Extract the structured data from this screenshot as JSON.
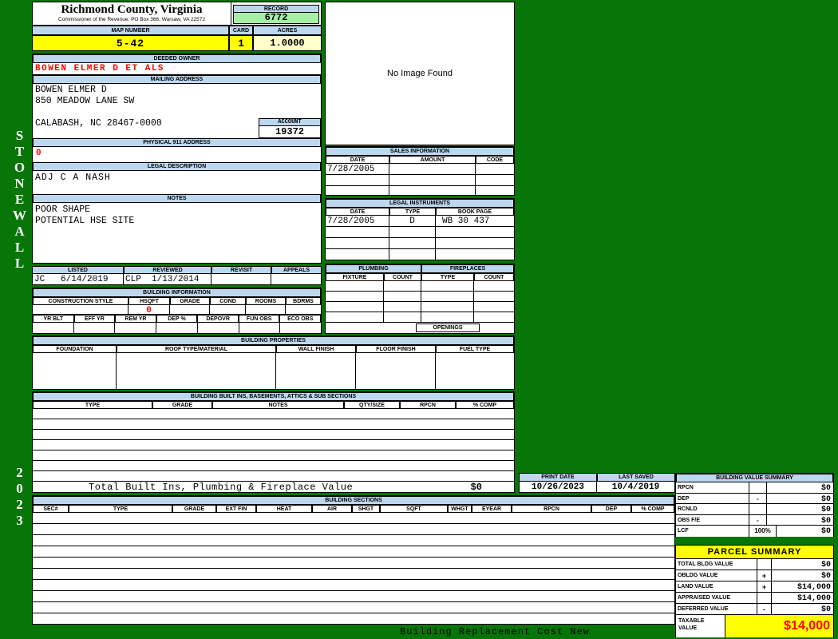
{
  "colors": {
    "page_background": "#077507",
    "section_header_blue": "#BDD7EE",
    "highlight_yellow": "#FFFF00",
    "acres_cream": "#FFFFCC",
    "record_green": "#A6F0A6",
    "alert_red": "#FF0000"
  },
  "sidebar": {
    "district": "STONEWALL",
    "year": "2023"
  },
  "header": {
    "county_title": "Richmond County, Virginia",
    "county_subtitle": "Commissioner of the Revenue, PO Box 366, Warsaw, VA 22572",
    "record_label": "RECORD",
    "record_value": "6772",
    "map_number_label": "MAP NUMBER",
    "map_number_value": "5-42",
    "card_label": "CARD",
    "card_value": "1",
    "acres_label": "ACRES",
    "acres_value": "1.0000"
  },
  "image_box": {
    "message": "No Image Found"
  },
  "owner": {
    "deeded_owner_label": "DEEDED OWNER",
    "deeded_owner": "BOWEN ELMER D ET ALS",
    "mailing_address_label": "MAILING ADDRESS",
    "mailing_line1": "BOWEN ELMER D",
    "mailing_line2": "850 MEADOW LANE SW",
    "mailing_line3": "CALABASH, NC 28467-0000",
    "account_label": "ACCOUNT",
    "account_value": "19372",
    "physical_address_label": "PHYSICAL 911 ADDRESS",
    "physical_address_value": "0",
    "legal_description_label": "LEGAL DESCRIPTION",
    "legal_description": "ADJ C A NASH",
    "notes_label": "NOTES",
    "notes_line1": "POOR SHAPE",
    "notes_line2": "POTENTIAL HSE SITE"
  },
  "sales": {
    "title": "SALES INFORMATION",
    "columns": [
      "DATE",
      "AMOUNT",
      "CODE"
    ],
    "row1": {
      "date": "7/28/2005"
    }
  },
  "legal_instruments": {
    "title": "LEGAL INSTRUMENTS",
    "columns": [
      "DATE",
      "TYPE",
      "BOOK PAGE"
    ],
    "row1": {
      "date": "7/28/2005",
      "type": "D",
      "book_page": "WB 30 437"
    }
  },
  "plumbing": {
    "title": "PLUMBING",
    "columns": [
      "FIXTURE",
      "COUNT"
    ],
    "fireplaces_title": "FIREPLACES",
    "fireplaces_columns": [
      "TYPE",
      "COUNT"
    ],
    "openings_label": "OPENINGS"
  },
  "review": {
    "columns": [
      "LISTED",
      "REVIEWED",
      "REVISIT",
      "APPEALS"
    ],
    "listed_value": "JC   6/14/2019",
    "reviewed_value": "CLP  1/13/2014"
  },
  "building_info": {
    "title": "BUILDING INFORMATION",
    "columns_top": [
      "CONSTRUCTION STYLE",
      "HSQFT",
      "GRADE",
      "COND",
      "ROOMS",
      "BDRMS"
    ],
    "hsqft_value": "0",
    "columns_bottom": [
      "YR BLT",
      "EFF YR",
      "REM YR",
      "DEP %",
      "DEPOVR",
      "FUN OBS",
      "ECO OBS"
    ]
  },
  "building_properties": {
    "title": "BUILDING PROPERTIES",
    "columns": [
      "FOUNDATION",
      "ROOF TYPE/MATERIAL",
      "WALL FINISH",
      "FLOOR FINISH",
      "FUEL TYPE"
    ]
  },
  "built_ins": {
    "title": "BUILDING BUILT INS, BASEMENTS, ATTICS & SUB SECTIONS",
    "columns": [
      "TYPE",
      "GRADE",
      "NOTES",
      "QTY/SIZE",
      "RPCN",
      "% COMP"
    ],
    "total_label": "Total Built Ins, Plumbing & Fireplace Value",
    "total_value": "$0"
  },
  "print_info": {
    "print_date_label": "PRINT DATE",
    "print_date_value": "10/26/2023",
    "last_saved_label": "LAST SAVED",
    "last_saved_value": "10/4/2019"
  },
  "building_value_summary": {
    "title": "BUILDING VALUE SUMMARY",
    "rows": [
      {
        "label": "RPCN",
        "op": "",
        "value": "$0"
      },
      {
        "label": "DEP",
        "op": "-",
        "value": "$0"
      },
      {
        "label": "RCNLD",
        "op": "",
        "value": "$0"
      },
      {
        "label": "OBS F/E",
        "op": "-",
        "value": "$0"
      },
      {
        "label": "LCF",
        "op": "100%",
        "value": "$0"
      }
    ]
  },
  "building_sections": {
    "title": "BUILDING SECTIONS",
    "columns": [
      "SEC#",
      "TYPE",
      "GRADE",
      "EXT FIN",
      "HEAT",
      "AIR",
      "SHGT",
      "SQFT",
      "WHGT",
      "EYEAR",
      "RPCN",
      "DEP",
      "% COMP"
    ]
  },
  "parcel_summary": {
    "title": "PARCEL SUMMARY",
    "rows": [
      {
        "label": "TOTAL BLDG VALUE",
        "op": "",
        "value": "$0"
      },
      {
        "label": "OBLDG VALUE",
        "op": "+",
        "value": "$0"
      },
      {
        "label": "LAND VALUE",
        "op": "+",
        "value": "$14,000"
      },
      {
        "label": "APPRAISED VALUE",
        "op": "",
        "value": "$14,000"
      },
      {
        "label": "DEFERRED VALUE",
        "op": "-",
        "value": "$0"
      }
    ],
    "taxable_label": "TAXABLE VALUE",
    "taxable_value": "$14,000"
  },
  "footer": {
    "text": "Building Replacement Cost New"
  }
}
